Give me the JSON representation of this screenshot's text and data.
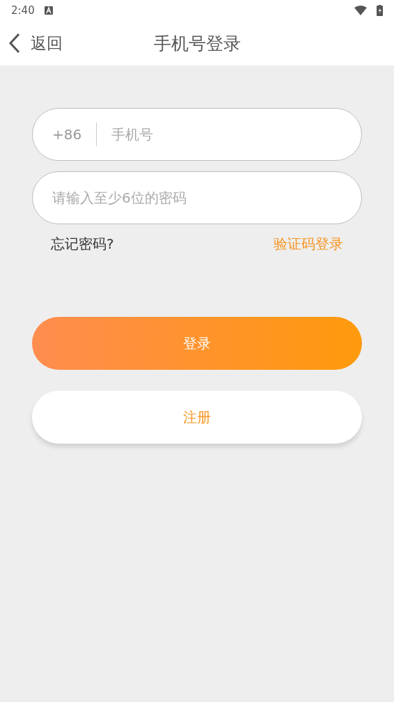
{
  "status_bar": {
    "time": "2:40"
  },
  "header": {
    "back": "返回",
    "title": "手机号登录"
  },
  "phone_field": {
    "prefix": "+86",
    "placeholder": "手机号"
  },
  "password_field": {
    "placeholder": "请输入至少6位的密码"
  },
  "links": {
    "forgot": "忘记密码?",
    "sms_login": "验证码登录"
  },
  "buttons": [
    {
      "kind": "primary",
      "label": "登录"
    },
    {
      "kind": "secondary",
      "label": "注册"
    }
  ]
}
